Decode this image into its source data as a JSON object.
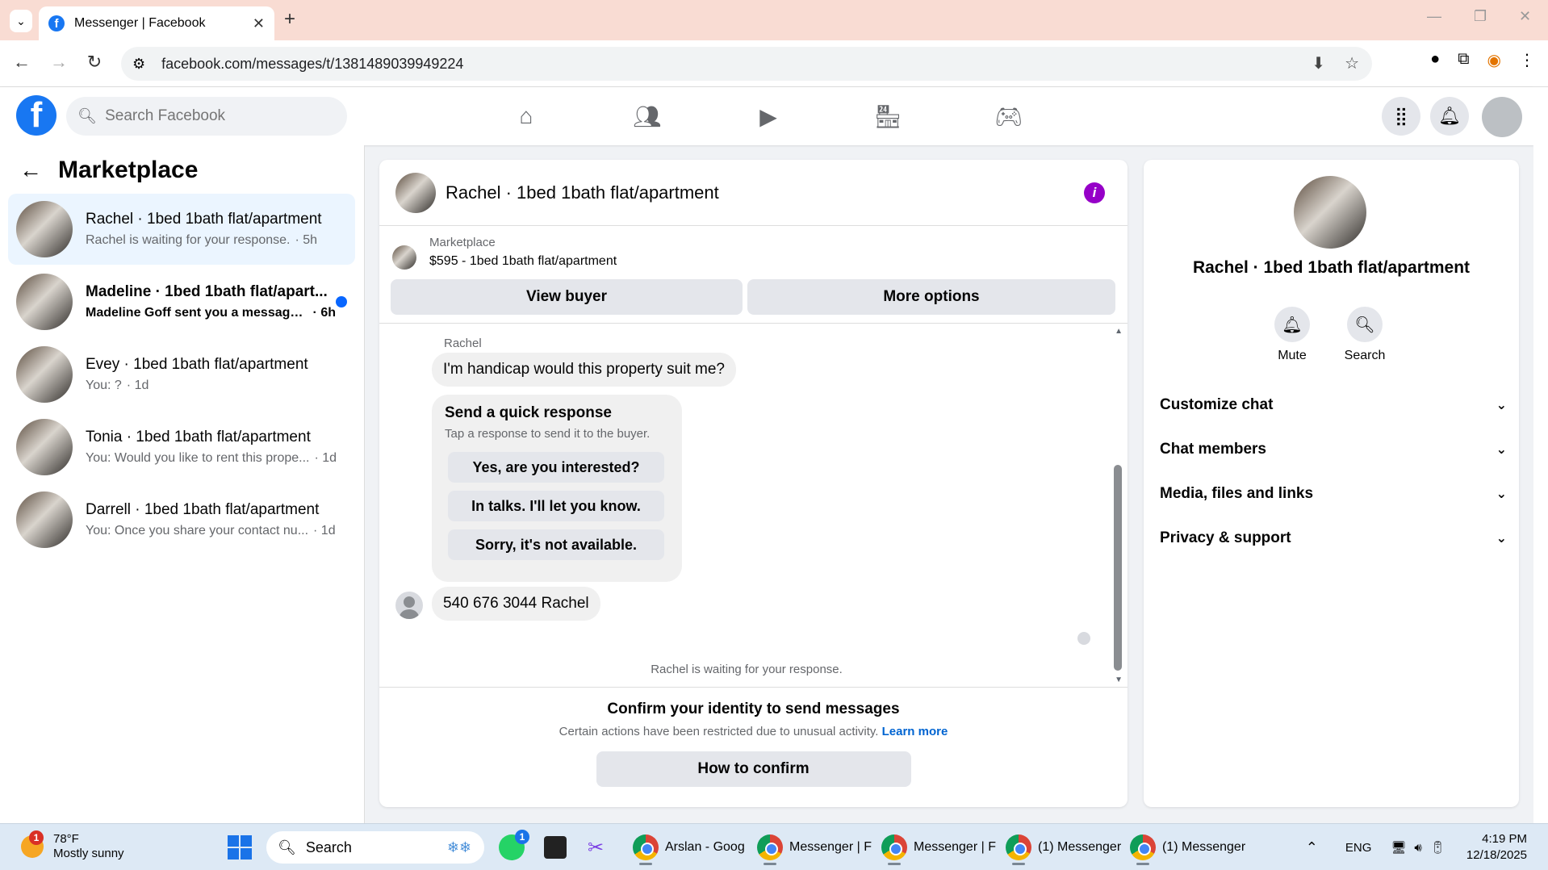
{
  "browser": {
    "tab_title": "Messenger | Facebook",
    "url": "facebook.com/messages/t/1381489039949224"
  },
  "header": {
    "search_placeholder": "Search Facebook"
  },
  "sidebar": {
    "heading": "Marketplace",
    "conversations": [
      {
        "name": "Rachel · 1bed 1bath flat/apartment",
        "preview": "Rachel is waiting for your response.",
        "time": "· 5h",
        "active": true,
        "unread": false
      },
      {
        "name": "Madeline · 1bed 1bath flat/apart...",
        "preview": "Madeline Goff sent you a message...",
        "time": "· 6h",
        "active": false,
        "unread": true
      },
      {
        "name": "Evey · 1bed 1bath flat/apartment",
        "preview": "You: ?",
        "time": "· 1d",
        "active": false,
        "unread": false
      },
      {
        "name": "Tonia · 1bed 1bath flat/apartment",
        "preview": "You: Would you like to rent this prope...",
        "time": "· 1d",
        "active": false,
        "unread": false
      },
      {
        "name": "Darrell · 1bed 1bath flat/apartment",
        "preview": "You: Once you share your contact nu...",
        "time": "· 1d",
        "active": false,
        "unread": false
      }
    ]
  },
  "chat": {
    "title": "Rachel · 1bed 1bath flat/apartment",
    "listing_label": "Marketplace",
    "listing_desc": "$595 - 1bed 1bath flat/apartment",
    "view_buyer": "View buyer",
    "more_options": "More options",
    "sender": "Rachel",
    "message_1": "I'm handicap would this property suit me?",
    "quick_title": "Send a quick response",
    "quick_sub": "Tap a response to send it to the buyer.",
    "quick_responses": [
      "Yes, are you interested?",
      "In talks. I'll let you know.",
      "Sorry, it's not available."
    ],
    "message_2": "540 676 3044 Rachel",
    "waiting": "Rachel is waiting for your response.",
    "confirm_title": "Confirm your identity to send messages",
    "confirm_sub": "Certain actions have been restricted due to unusual activity.",
    "learn_more": "Learn more",
    "confirm_button": "How to confirm"
  },
  "right_panel": {
    "name": "Rachel · 1bed 1bath flat/apartment",
    "mute": "Mute",
    "search": "Search",
    "sections": [
      "Customize chat",
      "Chat members",
      "Media, files and links",
      "Privacy & support"
    ]
  },
  "taskbar": {
    "temp": "78°F",
    "condition": "Mostly sunny",
    "weather_badge": "1",
    "search": "Search",
    "whatsapp_badge": "1",
    "apps": [
      "Arslan - Goog",
      "Messenger | F",
      "Messenger | F",
      "(1) Messenger",
      "(1) Messenger"
    ],
    "lang": "ENG",
    "time": "4:19 PM",
    "date": "12/18/2025"
  },
  "colors": {
    "fb_blue": "#1877f2",
    "unread_dot": "#0866ff",
    "info_purple": "#9600c8",
    "tabbar": "#f9dcd3"
  }
}
